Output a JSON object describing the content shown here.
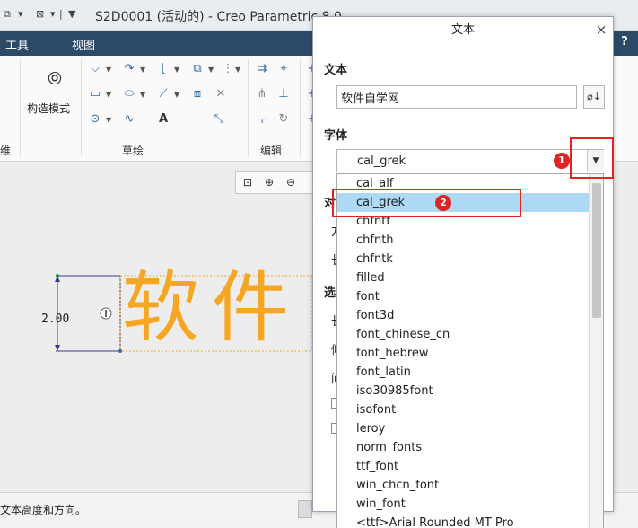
{
  "window": {
    "title": "S2D0001 (活动的) - Creo Parametric 8.0"
  },
  "menubar": {
    "tools": "工具",
    "view": "视图",
    "help": "?"
  },
  "ribbon": {
    "construct_mode": "构造模式",
    "sketch_group": "草绘",
    "edit_group": "编辑",
    "left_group_clip": "维"
  },
  "canvas": {
    "sketch_text": "软件自",
    "dimension": "2.00"
  },
  "status": {
    "message": "文本高度和方向。"
  },
  "dialog": {
    "title": "文本",
    "text_section": "文本",
    "text_value": "软件自学网",
    "font_section": "字体",
    "font_value": "cal_grek",
    "clipped_labels": [
      "对",
      "方",
      "长",
      "选",
      "长",
      "倾",
      "间"
    ],
    "font_options": [
      "cal_alf",
      "cal_grek",
      "chfntf",
      "chfnth",
      "chfntk",
      "filled",
      "font",
      "font3d",
      "font_chinese_cn",
      "font_hebrew",
      "font_latin",
      "iso30985font",
      "isofont",
      "leroy",
      "norm_fonts",
      "ttf_font",
      "win_chcn_font",
      "win_font",
      "<ttf>Arial Rounded MT Pro"
    ],
    "selected_index": 1
  },
  "annotations": {
    "badge_1": "1",
    "badge_2": "2"
  },
  "colors": {
    "sketch_text": "#f5a623",
    "highlight": "#aed9f5",
    "annotation": "#e02424",
    "menubar": "#2b4a68"
  }
}
